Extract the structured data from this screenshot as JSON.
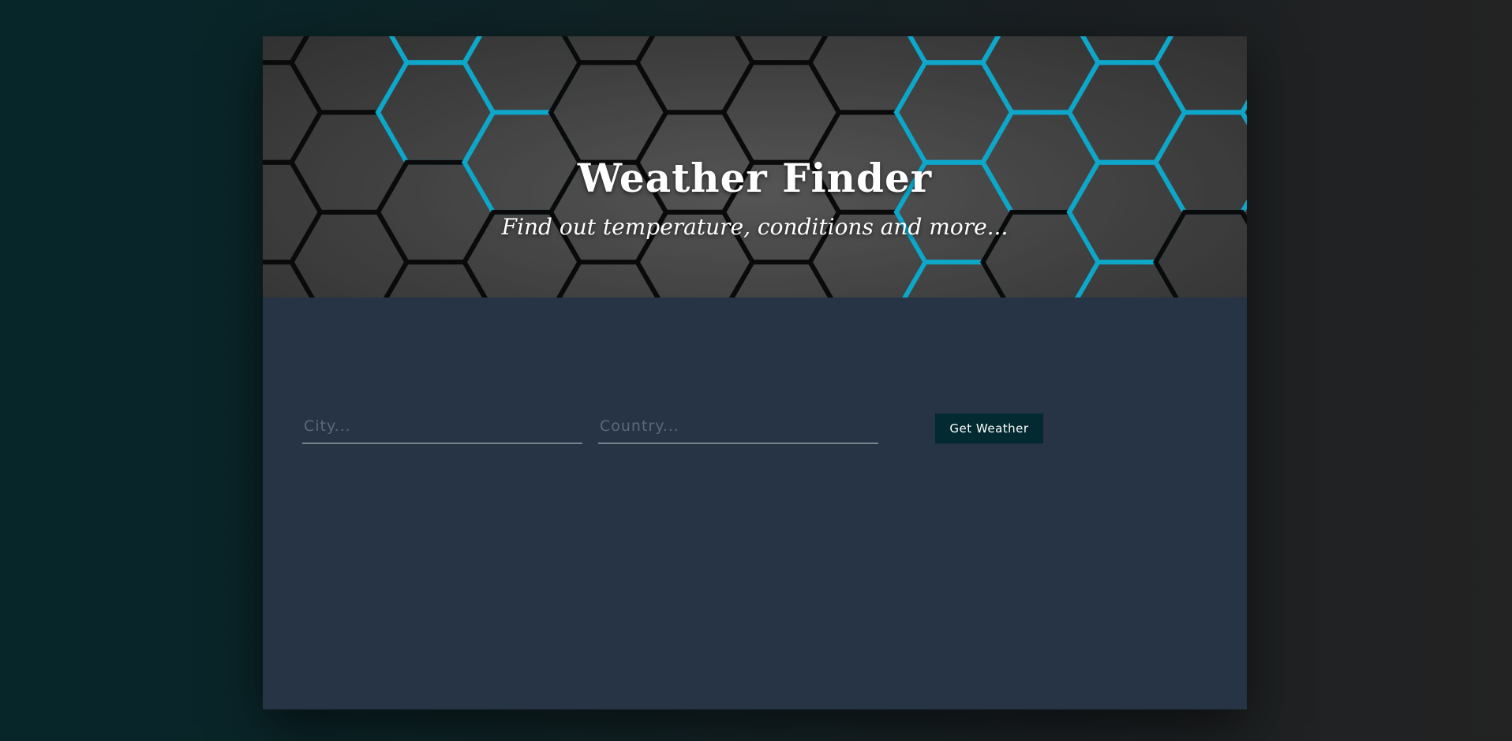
{
  "header": {
    "title": "Weather Finder",
    "subtitle": "Find out temperature, conditions and more..."
  },
  "form": {
    "city_placeholder": "City...",
    "city_value": "",
    "country_placeholder": "Country...",
    "country_value": "",
    "submit_label": "Get Weather"
  },
  "colors": {
    "card_background": "#263446",
    "button_background": "#032a30",
    "hex_accent": "#0ea6c9"
  }
}
